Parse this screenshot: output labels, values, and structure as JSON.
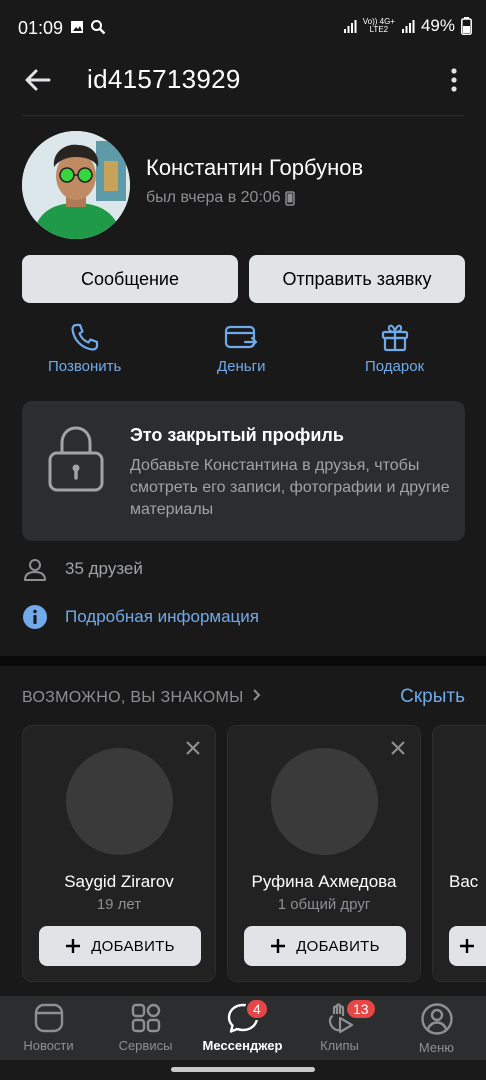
{
  "status_bar": {
    "time": "01:09",
    "net_top": "Vo)) 4G+",
    "net_bottom": "LTE2",
    "battery": "49%"
  },
  "header": {
    "title": "id415713929"
  },
  "profile": {
    "name": "Константин Горбунов",
    "last_seen": "был вчера в 20:06"
  },
  "buttons": {
    "message": "Сообщение",
    "send_request": "Отправить заявку"
  },
  "actions": {
    "call": "Позвонить",
    "money": "Деньги",
    "gift": "Подарок"
  },
  "private_profile": {
    "title": "Это закрытый профиль",
    "text": "Добавьте Константина в друзья, чтобы смотреть его записи, фотографии и другие материалы"
  },
  "friends": {
    "count_label": "35 друзей"
  },
  "details": {
    "label": "Подробная информация"
  },
  "suggestions": {
    "title": "ВОЗМОЖНО, ВЫ ЗНАКОМЫ",
    "hide": "Скрыть",
    "add_label": "ДОБАВИТЬ",
    "cards": [
      {
        "name": "Saygid Zirarov",
        "sub": "19 лет"
      },
      {
        "name": "Руфина Ахмедова",
        "sub": "1 общий друг"
      },
      {
        "name": "Вас",
        "sub": ""
      }
    ]
  },
  "tabbar": {
    "tabs": [
      {
        "label": "Новости",
        "icon": "news-icon"
      },
      {
        "label": "Сервисы",
        "icon": "services-icon"
      },
      {
        "label": "Мессенджер",
        "icon": "messenger-icon",
        "badge": "4",
        "active": true
      },
      {
        "label": "Клипы",
        "icon": "clips-icon",
        "badge": "13"
      },
      {
        "label": "Меню",
        "icon": "menu-profile-icon"
      }
    ]
  },
  "colors": {
    "background": "#191919",
    "accent": "#71aaeb",
    "card": "#2c2d2e",
    "badge": "#e64646"
  }
}
